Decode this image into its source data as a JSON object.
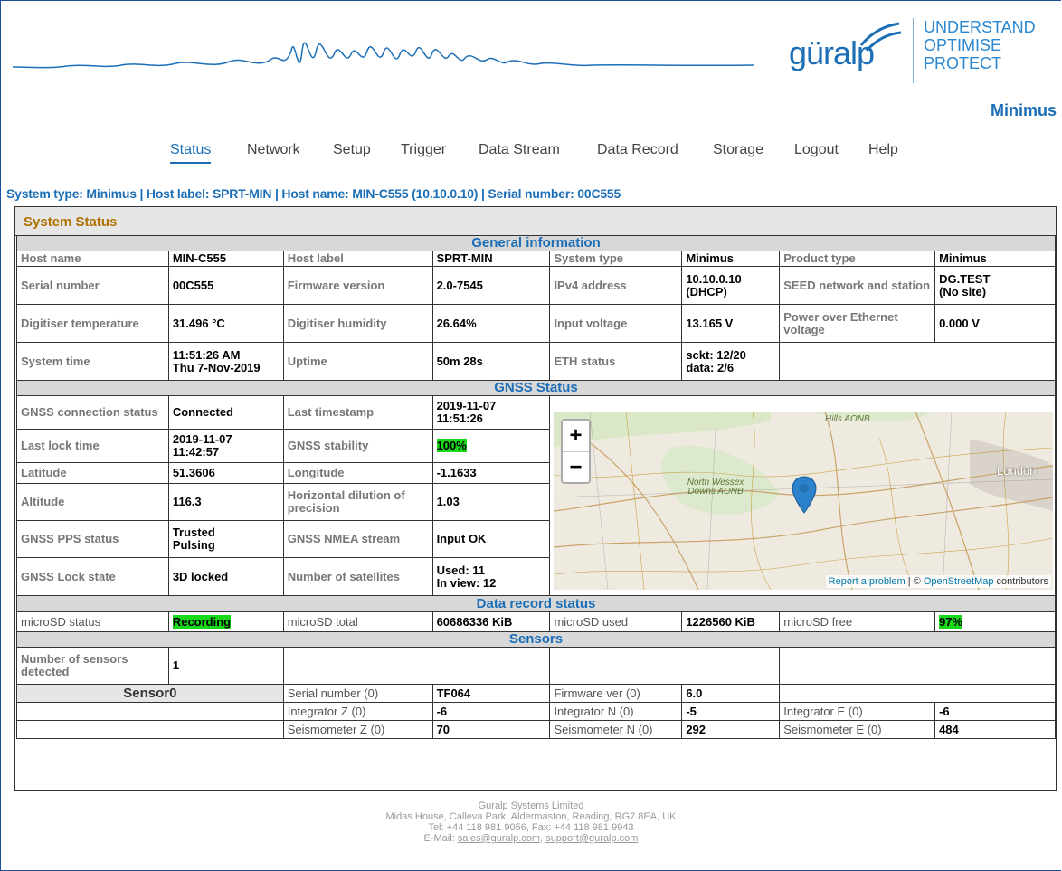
{
  "header": {
    "logo_text": "güralp",
    "tagline": [
      "UNDERSTAND",
      "OPTIMISE",
      "PROTECT"
    ],
    "product": "Minimus"
  },
  "nav": {
    "items": [
      "Status",
      "Network",
      "Setup",
      "Trigger",
      "Data Stream",
      "Data Record",
      "Storage",
      "Logout",
      "Help"
    ],
    "active": "Status"
  },
  "system_line": "System type: Minimus | Host label: SPRT-MIN | Host name: MIN-C555 (10.10.0.10) | Serial number: 00C555",
  "status": {
    "title": "System Status",
    "general": {
      "title": "General information",
      "host_name_label": "Host name",
      "host_name": "MIN-C555",
      "host_label_label": "Host label",
      "host_label": "SPRT-MIN",
      "system_type_label": "System type",
      "system_type": "Minimus",
      "product_type_label": "Product type",
      "product_type": "Minimus",
      "serial_label": "Serial number",
      "serial": "00C555",
      "firmware_label": "Firmware version",
      "firmware": "2.0-7545",
      "ipv4_label": "IPv4 address",
      "ipv4_1": "10.10.0.10",
      "ipv4_2": "(DHCP)",
      "seed_label": "SEED network and station",
      "seed_1": "DG.TEST",
      "seed_2": "(No site)",
      "temp_label": "Digitiser temperature",
      "temp": "31.496 °C",
      "humidity_label": "Digitiser humidity",
      "humidity": "26.64%",
      "voltage_label": "Input voltage",
      "voltage": "13.165 V",
      "poe_label": "Power over Ethernet voltage",
      "poe": "0.000 V",
      "time_label": "System time",
      "time_1": "11:51:26 AM",
      "time_2": "Thu 7-Nov-2019",
      "uptime_label": "Uptime",
      "uptime": "50m 28s",
      "eth_label": "ETH status",
      "eth_1": "sckt: 12/20",
      "eth_2": "data: 2/6"
    },
    "gnss": {
      "title": "GNSS Status",
      "conn_label": "GNSS connection status",
      "conn": "Connected",
      "last_ts_label": "Last timestamp",
      "last_ts_1": "2019-11-07",
      "last_ts_2": "11:51:26",
      "lock_time_label": "Last lock time",
      "lock_time_1": "2019-11-07",
      "lock_time_2": "11:42:57",
      "stability_label": "GNSS stability",
      "stability": "100%",
      "lat_label": "Latitude",
      "lat": "51.3606",
      "lon_label": "Longitude",
      "lon": "-1.1633",
      "alt_label": "Altitude",
      "alt": "116.3",
      "hdop_label": "Horizontal dilution of precision",
      "hdop": "1.03",
      "pps_label": "GNSS PPS status",
      "pps_1": "Trusted",
      "pps_2": "Pulsing",
      "nmea_label": "GNSS NMEA stream",
      "nmea": "Input OK",
      "lock_state_label": "GNSS Lock state",
      "lock_state": "3D locked",
      "sats_label": "Number of satellites",
      "sats_1": "Used: 11",
      "sats_2": "In view: 12"
    },
    "map": {
      "zoom_in": "+",
      "zoom_out": "−",
      "label_hills": "Hills AONB",
      "label_wessex": "North Wessex Downs AONB",
      "label_london": "London",
      "attrib_report": "Report a problem",
      "attrib_sep": " | © ",
      "attrib_osm": "OpenStreetMap",
      "attrib_rest": " contributors"
    },
    "record": {
      "title": "Data record status",
      "sd_status_label": "microSD status",
      "sd_status": "Recording",
      "sd_total_label": "microSD total",
      "sd_total": "60686336 KiB",
      "sd_used_label": "microSD used",
      "sd_used": "1226560 KiB",
      "sd_free_label": "microSD free",
      "sd_free": "97%"
    },
    "sensors": {
      "title": "Sensors",
      "count_label": "Number of sensors detected",
      "count": "1",
      "sensor0": "Sensor0",
      "serial_label": "Serial number (0)",
      "serial": "TF064",
      "fw_label": "Firmware ver (0)",
      "fw": "6.0",
      "int_z_label": "Integrator Z (0)",
      "int_z": "-6",
      "int_n_label": "Integrator N (0)",
      "int_n": "-5",
      "int_e_label": "Integrator E (0)",
      "int_e": "-6",
      "seis_z_label": "Seismometer Z (0)",
      "seis_z": "70",
      "seis_n_label": "Seismometer N (0)",
      "seis_n": "292",
      "seis_e_label": "Seismometer E (0)",
      "seis_e": "484"
    }
  },
  "footer": {
    "company": "Guralp Systems Limited",
    "address": "Midas House, Calleva Park, Aldermaston, Reading, RG7 8EA, UK",
    "phone": "Tel: +44 118 981 9056, Fax: +44 118 981 9943",
    "email_prefix": "E-Mail: ",
    "email_sales": "sales@guralp.com",
    "email_sep": ", ",
    "email_support": "support@guralp.com"
  }
}
